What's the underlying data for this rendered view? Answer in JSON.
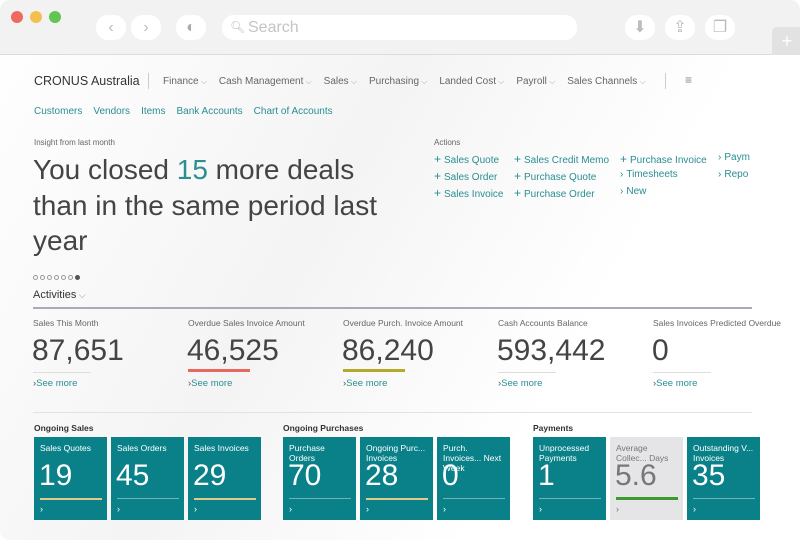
{
  "browser": {
    "search_placeholder": "Search",
    "colors": {
      "close": "#ec6a5e",
      "min": "#f4bf4f",
      "max": "#61c554"
    }
  },
  "header": {
    "company": "CRONUS Australia",
    "menus": [
      "Finance",
      "Cash Management",
      "Sales",
      "Purchasing",
      "Landed Cost",
      "Payroll",
      "Sales Channels"
    ],
    "links": [
      "Customers",
      "Vendors",
      "Items",
      "Bank Accounts",
      "Chart of Accounts"
    ]
  },
  "insight": {
    "label": "Insight from last month",
    "line1_pre": "You closed ",
    "highlight": "15",
    "line1_post": " more deals",
    "line2": "than in the same period last",
    "line3": "year",
    "pages": 7,
    "active_page": 7
  },
  "actions": {
    "label": "Actions",
    "columns": [
      [
        {
          "icon": "plus",
          "label": "Sales Quote"
        },
        {
          "icon": "plus",
          "label": "Sales Order"
        },
        {
          "icon": "plus",
          "label": "Sales Invoice"
        }
      ],
      [
        {
          "icon": "plus",
          "label": "Sales Credit Memo"
        },
        {
          "icon": "plus",
          "label": "Purchase Quote"
        },
        {
          "icon": "plus",
          "label": "Purchase Order"
        }
      ],
      [
        {
          "icon": "plus",
          "label": "Purchase Invoice"
        },
        {
          "icon": "chevron",
          "label": "Timesheets"
        },
        {
          "icon": "chevron",
          "label": "New"
        }
      ],
      [
        {
          "icon": "chevron",
          "label": "Paym"
        },
        {
          "icon": "chevron",
          "label": "Repo"
        }
      ]
    ]
  },
  "activities": {
    "title": "Activities",
    "see_more": "See more",
    "cues": [
      {
        "label": "Sales This Month",
        "value": "87,651",
        "indicator": ""
      },
      {
        "label": "Overdue Sales Invoice Amount",
        "value": "46,525",
        "indicator": "#e8675f"
      },
      {
        "label": "Overdue Purch. Invoice Amount",
        "value": "86,240",
        "indicator": "#b5a82a"
      },
      {
        "label": "Cash Accounts Balance",
        "value": "593,442",
        "indicator": ""
      },
      {
        "label": "Sales Invoices Predicted Overdue",
        "value": "0",
        "indicator": ""
      }
    ]
  },
  "groups": [
    {
      "title": "Ongoing Sales",
      "tiles": [
        {
          "label": "Sales Quotes",
          "value": "19",
          "indicator": "#e3c98a"
        },
        {
          "label": "Sales Orders",
          "value": "45",
          "indicator": ""
        },
        {
          "label": "Sales Invoices",
          "value": "29",
          "indicator": "#e3c98a"
        }
      ]
    },
    {
      "title": "Ongoing Purchases",
      "tiles": [
        {
          "label": "Purchase Orders",
          "value": "70",
          "indicator": ""
        },
        {
          "label": "Ongoing Purc... Invoices",
          "value": "28",
          "indicator": "#e3c98a"
        },
        {
          "label": "Purch. Invoices... Next Week",
          "value": "0",
          "indicator": ""
        }
      ]
    },
    {
      "title": "Payments",
      "tiles": [
        {
          "label": "Unprocessed Payments",
          "value": "1",
          "indicator": ""
        },
        {
          "label": "Average Collec... Days",
          "value": "5.6",
          "indicator": "#3a9a2e",
          "style": "gray"
        },
        {
          "label": "Outstanding V... Invoices",
          "value": "35",
          "indicator": ""
        }
      ]
    }
  ]
}
